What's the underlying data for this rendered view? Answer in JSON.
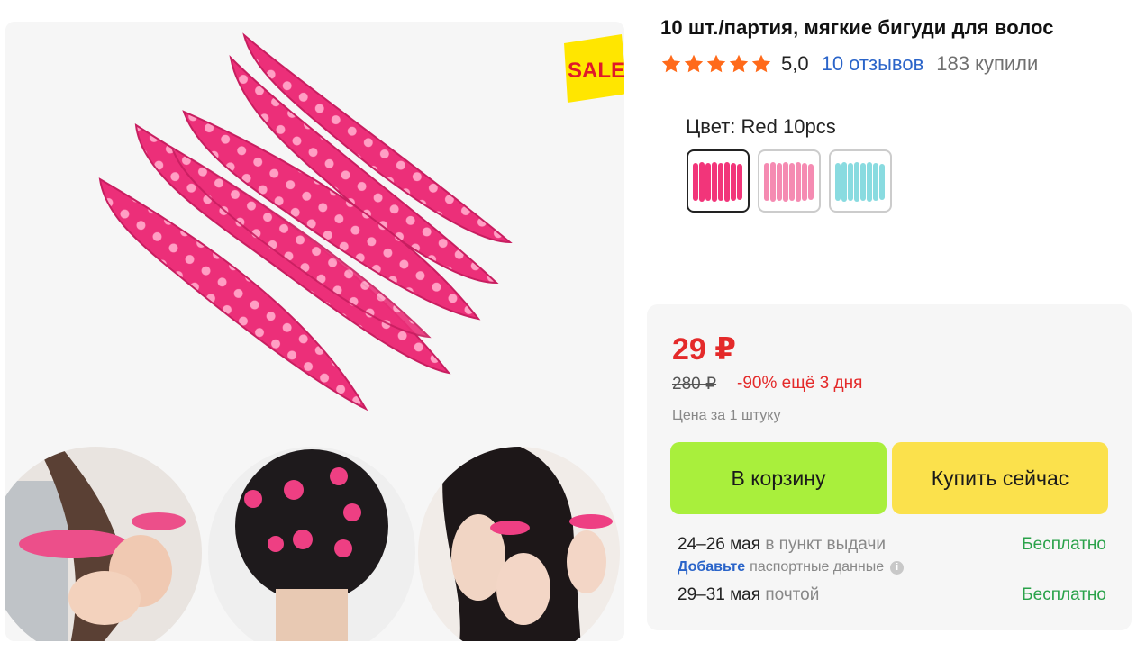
{
  "product": {
    "title": "10 шт./партия, мягкие бигуди для волос",
    "rating": "5,0",
    "reviews": "10 отзывов",
    "bought": "183 купили",
    "image_badge": "SALE"
  },
  "color": {
    "label": "Цвет: Red 10pcs",
    "options": [
      "Red 10pcs",
      "Pink 10pcs",
      "Blue 10pcs"
    ],
    "selected": 0,
    "swatch_colors": [
      "#f2357a",
      "#f58bb2",
      "#89dbe0"
    ]
  },
  "price": {
    "current": "29 ₽",
    "old": "280 ₽",
    "discount": "-90% ещё 3 дня",
    "unit": "Цена за 1 штуку"
  },
  "buttons": {
    "cart": "В корзину",
    "buy_now": "Купить сейчас"
  },
  "delivery": {
    "pickup_date": "24–26 мая",
    "pickup_method": "в пункт выдачи",
    "pickup_price": "Бесплатно",
    "passport_link": "Добавьте",
    "passport_text": "паспортные данные",
    "post_date": "29–31 мая",
    "post_method": "почтой",
    "post_price": "Бесплатно"
  },
  "colors": {
    "accent_red": "#e42a2a",
    "link_blue": "#2a64c9",
    "free_green": "#2aa24a",
    "cart_green": "#a9ef3c",
    "buy_yellow": "#fbe14c",
    "star_orange": "#ff6a1a"
  }
}
